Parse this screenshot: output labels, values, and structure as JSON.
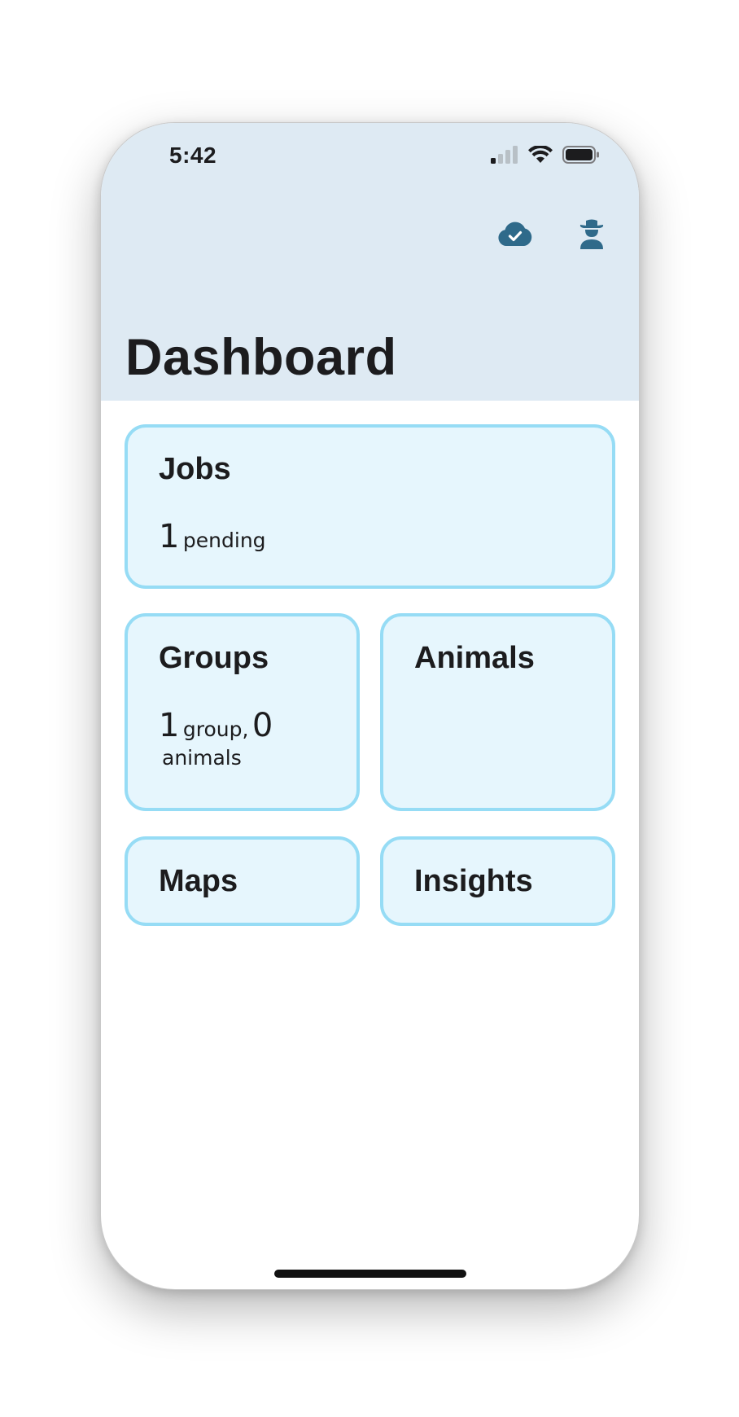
{
  "status_bar": {
    "time": "5:42"
  },
  "header": {
    "title": "Dashboard",
    "icons": [
      "cloud-check-icon",
      "cowboy-user-icon"
    ]
  },
  "cards": {
    "jobs": {
      "title": "Jobs",
      "count": "1",
      "count_label": "pending"
    },
    "groups": {
      "title": "Groups",
      "group_count": "1",
      "group_label": "group,",
      "animal_count": "0",
      "animal_label": "animals"
    },
    "animals": {
      "title": "Animals"
    },
    "maps": {
      "title": "Maps"
    },
    "insights": {
      "title": "Insights"
    }
  },
  "colors": {
    "header_bg": "#deeaf3",
    "card_bg": "#e6f6fd",
    "card_border": "#96dcf5",
    "icon_accent": "#2f6a8a",
    "text": "#1c1c1e"
  }
}
